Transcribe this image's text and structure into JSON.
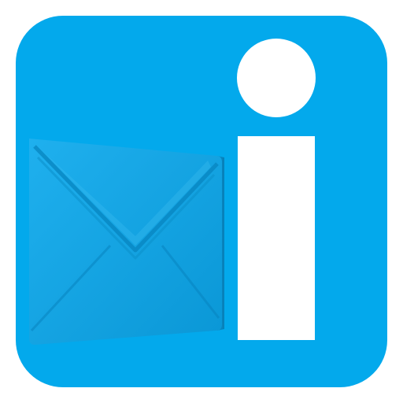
{
  "icon": {
    "tile_name": "mail-info-app-icon",
    "glyph_left": "envelope-icon",
    "glyph_right": "info-letter-i-icon"
  },
  "colors": {
    "tile": "#03a9ec",
    "tile_shadow": "#0594cf",
    "envelope_light": "#27b4f0",
    "envelope_mid": "#0fa0df",
    "envelope_dark": "#0784bf",
    "glyph": "#ffffff"
  }
}
